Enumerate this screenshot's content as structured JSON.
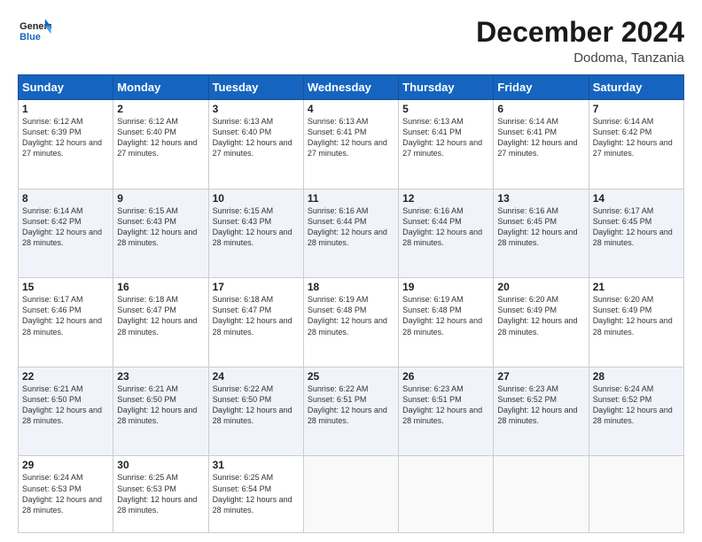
{
  "header": {
    "logo_general": "General",
    "logo_blue": "Blue",
    "month_title": "December 2024",
    "location": "Dodoma, Tanzania"
  },
  "days_of_week": [
    "Sunday",
    "Monday",
    "Tuesday",
    "Wednesday",
    "Thursday",
    "Friday",
    "Saturday"
  ],
  "weeks": [
    [
      {
        "day": 1,
        "sunrise": "6:12 AM",
        "sunset": "6:39 PM",
        "daylight": "12 hours and 27 minutes."
      },
      {
        "day": 2,
        "sunrise": "6:12 AM",
        "sunset": "6:40 PM",
        "daylight": "12 hours and 27 minutes."
      },
      {
        "day": 3,
        "sunrise": "6:13 AM",
        "sunset": "6:40 PM",
        "daylight": "12 hours and 27 minutes."
      },
      {
        "day": 4,
        "sunrise": "6:13 AM",
        "sunset": "6:41 PM",
        "daylight": "12 hours and 27 minutes."
      },
      {
        "day": 5,
        "sunrise": "6:13 AM",
        "sunset": "6:41 PM",
        "daylight": "12 hours and 27 minutes."
      },
      {
        "day": 6,
        "sunrise": "6:14 AM",
        "sunset": "6:41 PM",
        "daylight": "12 hours and 27 minutes."
      },
      {
        "day": 7,
        "sunrise": "6:14 AM",
        "sunset": "6:42 PM",
        "daylight": "12 hours and 27 minutes."
      }
    ],
    [
      {
        "day": 8,
        "sunrise": "6:14 AM",
        "sunset": "6:42 PM",
        "daylight": "12 hours and 28 minutes."
      },
      {
        "day": 9,
        "sunrise": "6:15 AM",
        "sunset": "6:43 PM",
        "daylight": "12 hours and 28 minutes."
      },
      {
        "day": 10,
        "sunrise": "6:15 AM",
        "sunset": "6:43 PM",
        "daylight": "12 hours and 28 minutes."
      },
      {
        "day": 11,
        "sunrise": "6:16 AM",
        "sunset": "6:44 PM",
        "daylight": "12 hours and 28 minutes."
      },
      {
        "day": 12,
        "sunrise": "6:16 AM",
        "sunset": "6:44 PM",
        "daylight": "12 hours and 28 minutes."
      },
      {
        "day": 13,
        "sunrise": "6:16 AM",
        "sunset": "6:45 PM",
        "daylight": "12 hours and 28 minutes."
      },
      {
        "day": 14,
        "sunrise": "6:17 AM",
        "sunset": "6:45 PM",
        "daylight": "12 hours and 28 minutes."
      }
    ],
    [
      {
        "day": 15,
        "sunrise": "6:17 AM",
        "sunset": "6:46 PM",
        "daylight": "12 hours and 28 minutes."
      },
      {
        "day": 16,
        "sunrise": "6:18 AM",
        "sunset": "6:47 PM",
        "daylight": "12 hours and 28 minutes."
      },
      {
        "day": 17,
        "sunrise": "6:18 AM",
        "sunset": "6:47 PM",
        "daylight": "12 hours and 28 minutes."
      },
      {
        "day": 18,
        "sunrise": "6:19 AM",
        "sunset": "6:48 PM",
        "daylight": "12 hours and 28 minutes."
      },
      {
        "day": 19,
        "sunrise": "6:19 AM",
        "sunset": "6:48 PM",
        "daylight": "12 hours and 28 minutes."
      },
      {
        "day": 20,
        "sunrise": "6:20 AM",
        "sunset": "6:49 PM",
        "daylight": "12 hours and 28 minutes."
      },
      {
        "day": 21,
        "sunrise": "6:20 AM",
        "sunset": "6:49 PM",
        "daylight": "12 hours and 28 minutes."
      }
    ],
    [
      {
        "day": 22,
        "sunrise": "6:21 AM",
        "sunset": "6:50 PM",
        "daylight": "12 hours and 28 minutes."
      },
      {
        "day": 23,
        "sunrise": "6:21 AM",
        "sunset": "6:50 PM",
        "daylight": "12 hours and 28 minutes."
      },
      {
        "day": 24,
        "sunrise": "6:22 AM",
        "sunset": "6:50 PM",
        "daylight": "12 hours and 28 minutes."
      },
      {
        "day": 25,
        "sunrise": "6:22 AM",
        "sunset": "6:51 PM",
        "daylight": "12 hours and 28 minutes."
      },
      {
        "day": 26,
        "sunrise": "6:23 AM",
        "sunset": "6:51 PM",
        "daylight": "12 hours and 28 minutes."
      },
      {
        "day": 27,
        "sunrise": "6:23 AM",
        "sunset": "6:52 PM",
        "daylight": "12 hours and 28 minutes."
      },
      {
        "day": 28,
        "sunrise": "6:24 AM",
        "sunset": "6:52 PM",
        "daylight": "12 hours and 28 minutes."
      }
    ],
    [
      {
        "day": 29,
        "sunrise": "6:24 AM",
        "sunset": "6:53 PM",
        "daylight": "12 hours and 28 minutes."
      },
      {
        "day": 30,
        "sunrise": "6:25 AM",
        "sunset": "6:53 PM",
        "daylight": "12 hours and 28 minutes."
      },
      {
        "day": 31,
        "sunrise": "6:25 AM",
        "sunset": "6:54 PM",
        "daylight": "12 hours and 28 minutes."
      },
      null,
      null,
      null,
      null
    ]
  ]
}
